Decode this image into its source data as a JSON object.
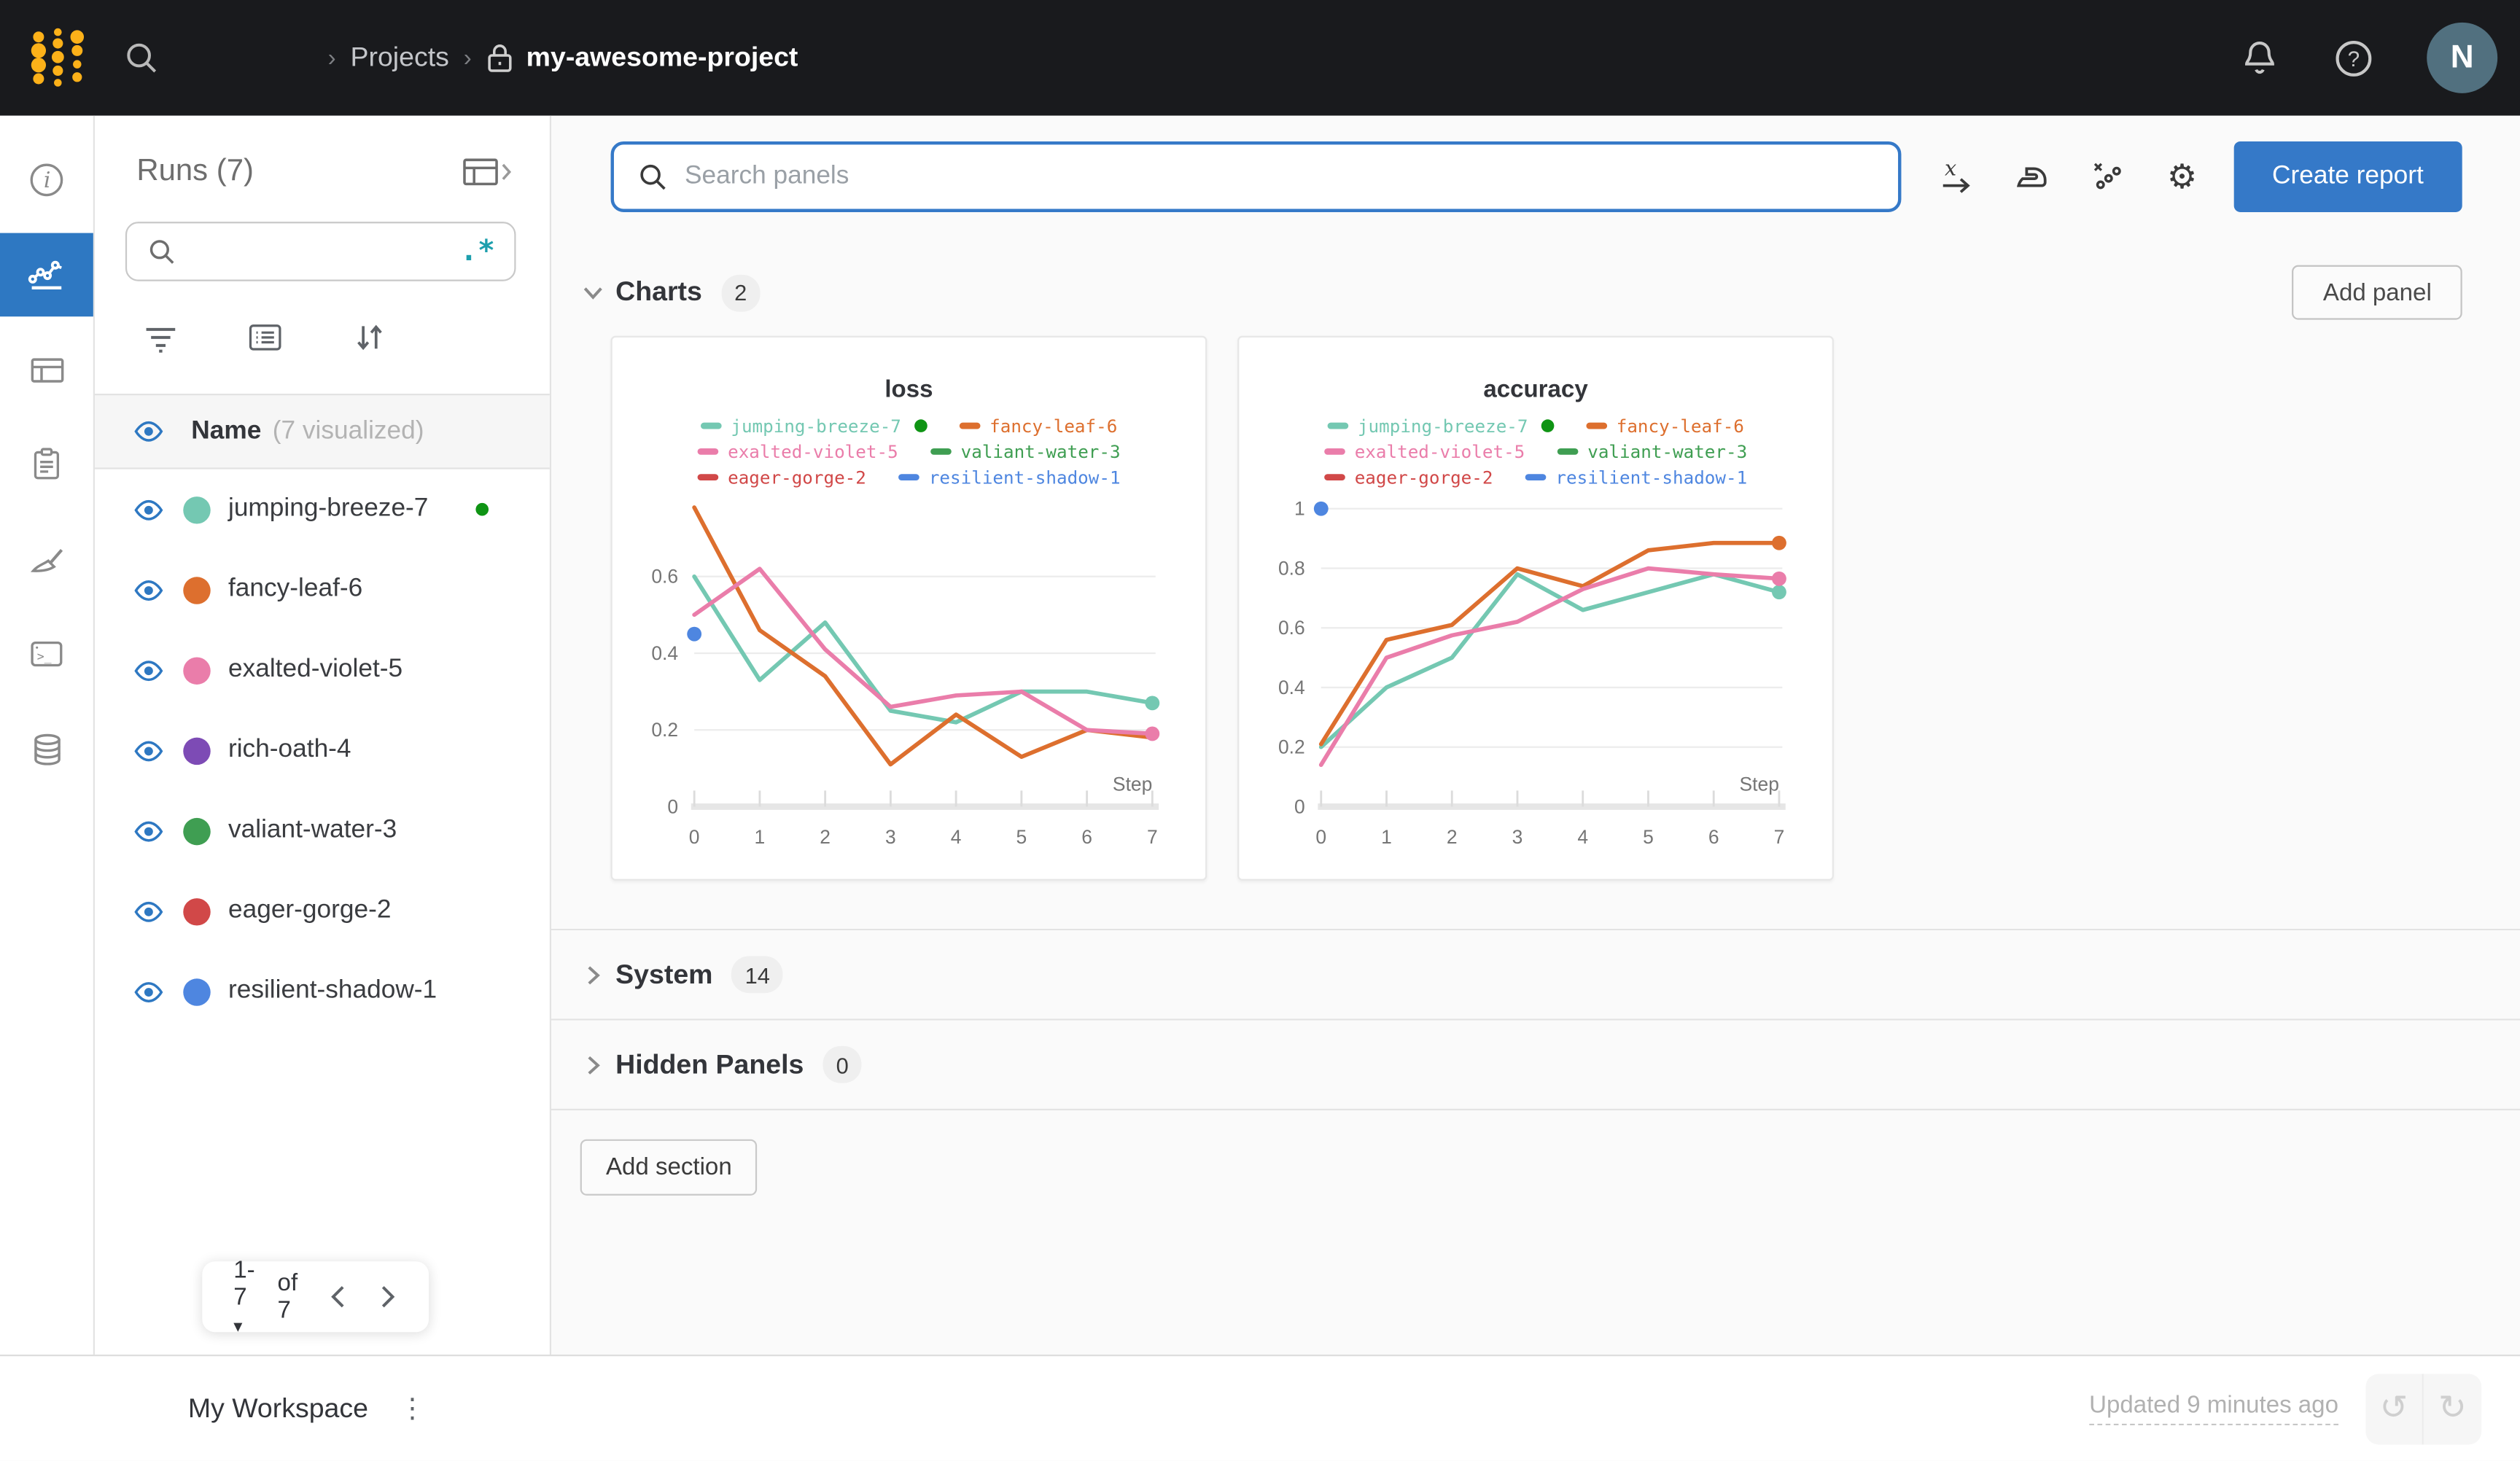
{
  "topbar": {
    "breadcrumb_root": "Projects",
    "project_name": "my-awesome-project",
    "avatar_initial": "N"
  },
  "left_rail": {
    "items": [
      "info",
      "workspace-charts",
      "runs-table",
      "jobs",
      "sweeps",
      "terminal",
      "artifacts"
    ],
    "selected_index": 1,
    "selected_color": "#2e78c2"
  },
  "runs_panel": {
    "title": "Runs (7)",
    "search_placeholder": "",
    "regex_icon": ".*",
    "header_name": "Name",
    "header_visualized": "(7 visualized)",
    "runs": [
      {
        "name": "jumping-breeze-7",
        "color": "#74c8b2",
        "running": true
      },
      {
        "name": "fancy-leaf-6",
        "color": "#dd6f2e",
        "running": false
      },
      {
        "name": "exalted-violet-5",
        "color": "#ea7daa",
        "running": false
      },
      {
        "name": "rich-oath-4",
        "color": "#7d4bb5",
        "running": false
      },
      {
        "name": "valiant-water-3",
        "color": "#3f9e52",
        "running": false
      },
      {
        "name": "eager-gorge-2",
        "color": "#d14848",
        "running": false
      },
      {
        "name": "resilient-shadow-1",
        "color": "#4e86e0",
        "running": false
      }
    ],
    "pagination": {
      "range": "1-7",
      "of": "of 7"
    }
  },
  "main": {
    "panel_search_placeholder": "Search panels",
    "create_report_label": "Create report",
    "add_panel_label": "Add panel",
    "sections": {
      "charts": {
        "label": "Charts",
        "count": "2"
      },
      "system": {
        "label": "System",
        "count": "14"
      },
      "hidden": {
        "label": "Hidden Panels",
        "count": "0"
      }
    },
    "add_section_label": "Add section"
  },
  "footer": {
    "workspace_label": "My Workspace",
    "updated_text": "Updated 9 minutes ago"
  },
  "chart_data": [
    {
      "type": "line",
      "title": "loss",
      "xlabel": "Step",
      "x": [
        0,
        1,
        2,
        3,
        4,
        5,
        6,
        7
      ],
      "yticks": [
        0,
        0.2,
        0.4,
        0.6
      ],
      "ylim": [
        0,
        0.8
      ],
      "legend_position": "top",
      "grid": true,
      "series": [
        {
          "name": "jumping-breeze-7",
          "color": "#74c8b2",
          "running_marker": true,
          "end_dot": true,
          "values": [
            0.6,
            0.33,
            0.48,
            0.25,
            0.22,
            0.3,
            0.3,
            0.27
          ]
        },
        {
          "name": "fancy-leaf-6",
          "color": "#dd6f2e",
          "end_dot": false,
          "values": [
            0.78,
            0.46,
            0.34,
            0.11,
            0.24,
            0.13,
            0.2,
            0.18
          ]
        },
        {
          "name": "exalted-violet-5",
          "color": "#ea7daa",
          "end_dot": true,
          "values": [
            0.5,
            0.62,
            0.41,
            0.26,
            0.29,
            0.3,
            0.2,
            0.19
          ]
        },
        {
          "name": "valiant-water-3",
          "color": "#3f9e52",
          "values": []
        },
        {
          "name": "eager-gorge-2",
          "color": "#d14848",
          "values": []
        },
        {
          "name": "resilient-shadow-1",
          "color": "#4e86e0",
          "point_only": true,
          "values": [
            0.45
          ]
        }
      ]
    },
    {
      "type": "line",
      "title": "accuracy",
      "xlabel": "Step",
      "x": [
        0,
        1,
        2,
        3,
        4,
        5,
        6,
        7
      ],
      "yticks": [
        0,
        0.2,
        0.4,
        0.6,
        0.8,
        1
      ],
      "ylim": [
        0,
        1.03
      ],
      "legend_position": "top",
      "grid": true,
      "series": [
        {
          "name": "jumping-breeze-7",
          "color": "#74c8b2",
          "running_marker": true,
          "end_dot": true,
          "values": [
            0.2,
            0.4,
            0.5,
            0.78,
            0.66,
            0.72,
            0.78,
            0.72
          ]
        },
        {
          "name": "fancy-leaf-6",
          "color": "#dd6f2e",
          "end_dot": true,
          "values": [
            0.21,
            0.56,
            0.61,
            0.8,
            0.74,
            0.86,
            0.885,
            0.885
          ]
        },
        {
          "name": "exalted-violet-5",
          "color": "#ea7daa",
          "end_dot": true,
          "values": [
            0.14,
            0.5,
            0.575,
            0.62,
            0.73,
            0.8,
            0.78,
            0.765
          ]
        },
        {
          "name": "valiant-water-3",
          "color": "#3f9e52",
          "values": []
        },
        {
          "name": "eager-gorge-2",
          "color": "#d14848",
          "values": []
        },
        {
          "name": "resilient-shadow-1",
          "color": "#4e86e0",
          "point_only": true,
          "values": [
            1.0
          ]
        }
      ]
    }
  ]
}
